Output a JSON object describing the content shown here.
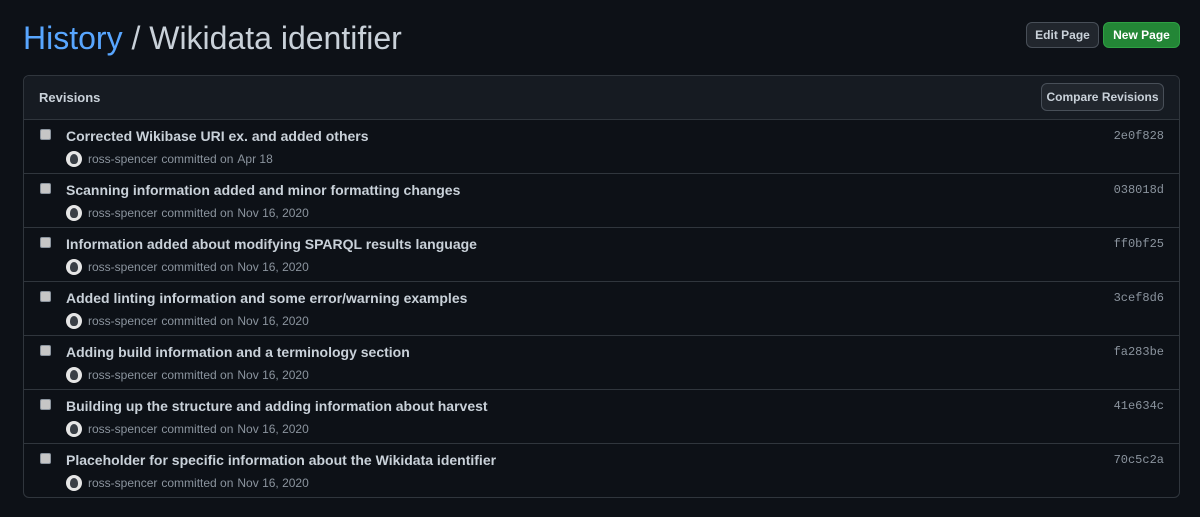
{
  "breadcrumb": {
    "history_label": "History",
    "separator": " / ",
    "page_title": "Wikidata identifier"
  },
  "header_buttons": {
    "edit_label": "Edit Page",
    "new_label": "New Page"
  },
  "revisions": {
    "title": "Revisions",
    "compare_label": "Compare Revisions",
    "items": [
      {
        "message": "Corrected Wikibase URI ex. and added others",
        "author": "ross-spencer",
        "verb": "committed on",
        "date": "Apr 18",
        "sha": "2e0f828"
      },
      {
        "message": "Scanning information added and minor formatting changes",
        "author": "ross-spencer",
        "verb": "committed on",
        "date": "Nov 16, 2020",
        "sha": "038018d"
      },
      {
        "message": "Information added about modifying SPARQL results language",
        "author": "ross-spencer",
        "verb": "committed on",
        "date": "Nov 16, 2020",
        "sha": "ff0bf25"
      },
      {
        "message": "Added linting information and some error/warning examples",
        "author": "ross-spencer",
        "verb": "committed on",
        "date": "Nov 16, 2020",
        "sha": "3cef8d6"
      },
      {
        "message": "Adding build information and a terminology section",
        "author": "ross-spencer",
        "verb": "committed on",
        "date": "Nov 16, 2020",
        "sha": "fa283be"
      },
      {
        "message": "Building up the structure and adding information about harvest",
        "author": "ross-spencer",
        "verb": "committed on",
        "date": "Nov 16, 2020",
        "sha": "41e634c"
      },
      {
        "message": "Placeholder for specific information about the Wikidata identifier",
        "author": "ross-spencer",
        "verb": "committed on",
        "date": "Nov 16, 2020",
        "sha": "70c5c2a"
      }
    ]
  },
  "colors": {
    "background": "#0d1117",
    "link": "#58a6ff",
    "primary_button": "#238636",
    "border": "#30363d"
  }
}
